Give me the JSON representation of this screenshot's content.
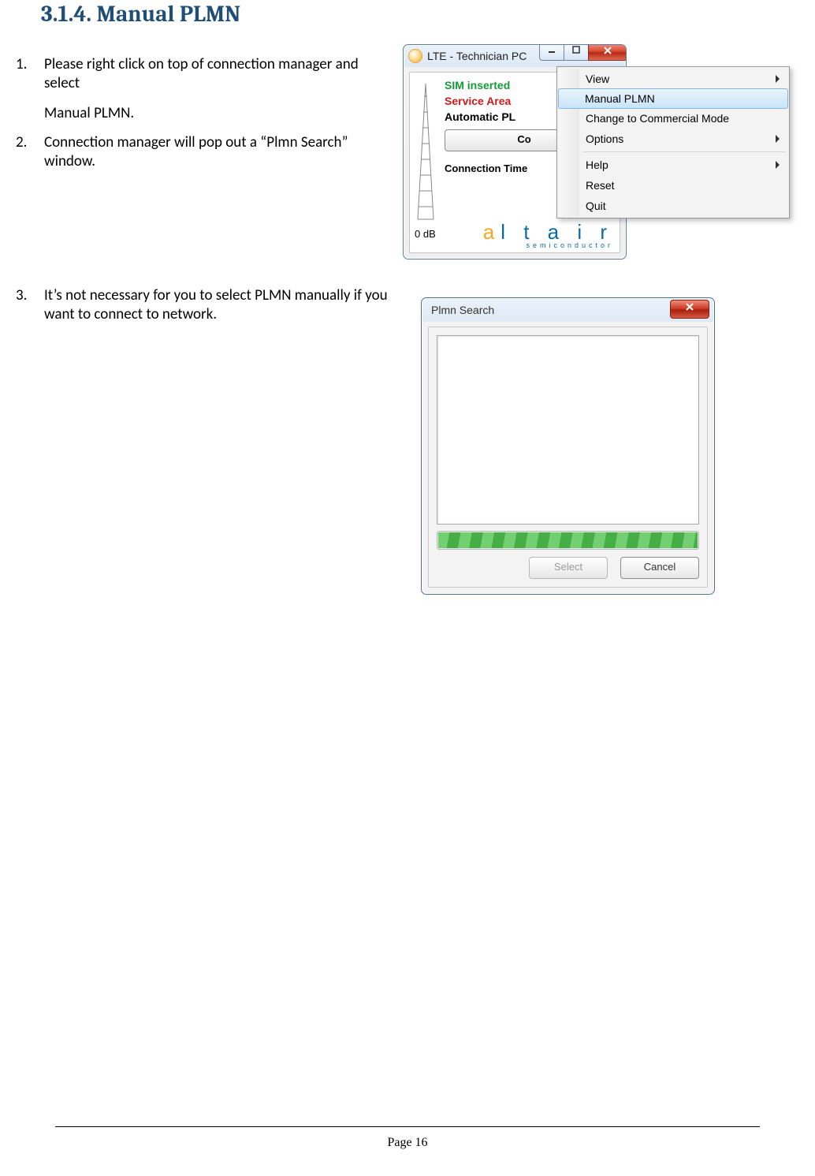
{
  "heading": "3.1.4. Manual PLMN",
  "steps": [
    {
      "num": "1.",
      "paras": [
        "Please right click on top of connection manager and select",
        "Manual PLMN."
      ]
    },
    {
      "num": "2.",
      "paras": [
        "Connection manager will pop out a “Plmn Search” window."
      ]
    },
    {
      "num": "3.",
      "paras": [
        "It’s not necessary for you to select PLMN manually if you want to connect to network."
      ]
    }
  ],
  "fig1": {
    "title": "LTE - Technician PC",
    "sim": "SIM inserted",
    "service": "Service Area",
    "plmn": "Automatic PL",
    "connect": "Co",
    "ctime": "Connection Time",
    "db": "0 dB",
    "logo1": "altair",
    "logo2": "semiconductor",
    "menu": {
      "view": "View",
      "manual": "Manual PLMN",
      "change": "Change to Commercial Mode",
      "options": "Options",
      "help": "Help",
      "reset": "Reset",
      "quit": "Quit"
    }
  },
  "fig2": {
    "title": "Plmn Search",
    "select": "Select",
    "cancel": "Cancel"
  },
  "page": "Page 16"
}
